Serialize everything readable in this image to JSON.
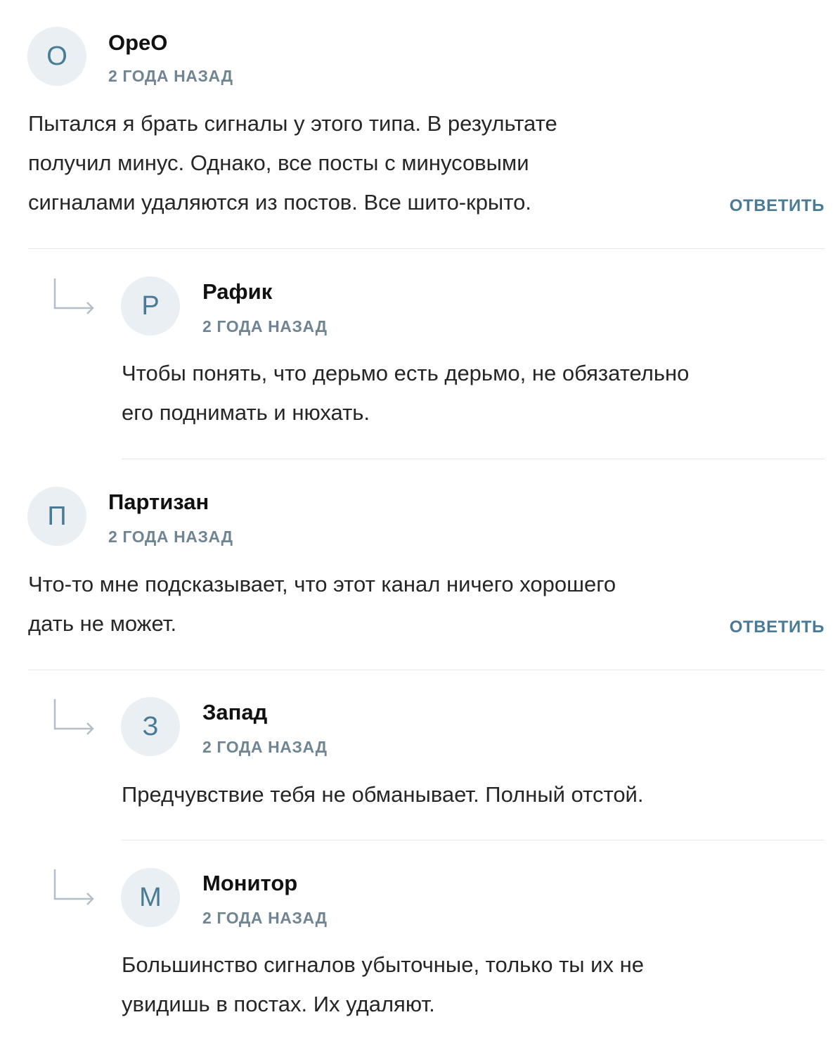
{
  "colors": {
    "accent": "#4a7b95",
    "avatar_bg": "#eaeff3",
    "meta": "#6f8593",
    "divider": "#e6e9ec"
  },
  "comments": [
    {
      "initial": "O",
      "author": "OpeO",
      "time": "2 ГОДА НАЗАД",
      "lines": [
        "Пытался я брать сигналы у этого типа. В результате",
        "получил минус. Однако, все посты с минусовыми",
        "сигналами удаляются из постов. Все шито-крыто."
      ],
      "reply_label": "ОТВЕТИТЬ"
    },
    {
      "initial": "Р",
      "author": "Рафик",
      "time": "2 ГОДА НАЗАД",
      "lines": [
        "Чтобы понять, что дерьмо есть дерьмо, не обязательно",
        "его поднимать и нюхать."
      ]
    },
    {
      "initial": "П",
      "author": "Партизан",
      "time": "2 ГОДА НАЗАД",
      "lines": [
        "Что-то мне подсказывает, что этот канал ничего хорошего",
        "дать не может."
      ],
      "reply_label": "ОТВЕТИТЬ"
    },
    {
      "initial": "З",
      "author": "Запад",
      "time": "2 ГОДА НАЗАД",
      "lines": [
        "Предчувствие тебя не обманывает. Полный отстой."
      ]
    },
    {
      "initial": "М",
      "author": "Монитор",
      "time": "2 ГОДА НАЗАД",
      "lines": [
        "Большинство сигналов убыточные, только ты их не",
        "увидишь в постах. Их удаляют."
      ]
    }
  ]
}
